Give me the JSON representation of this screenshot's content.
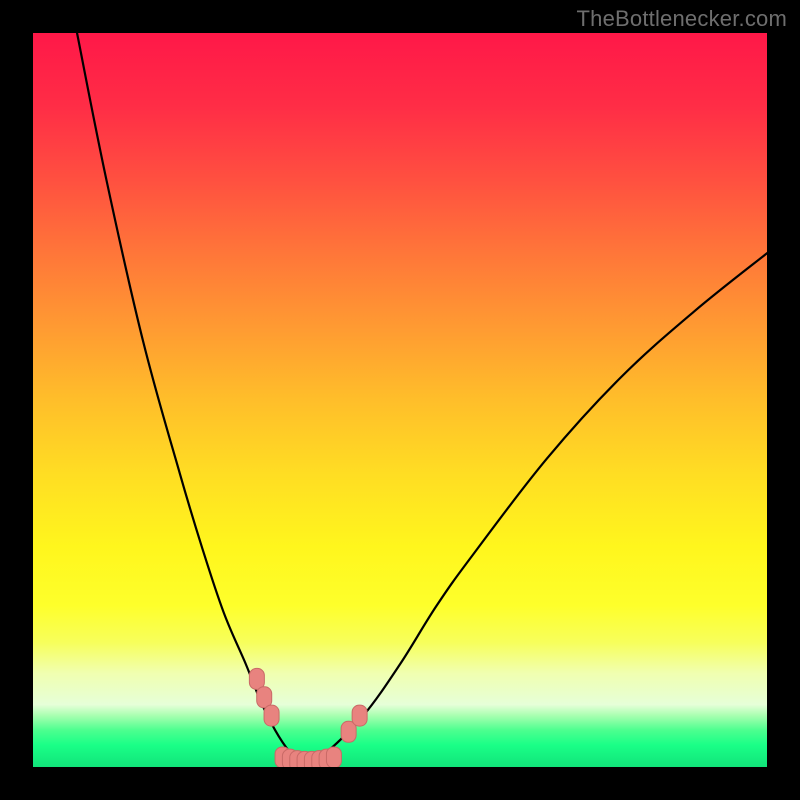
{
  "watermark_text": "TheBottlenecker.com",
  "colors": {
    "gradient_stops": [
      {
        "offset": 0.0,
        "hex": "#ff1848"
      },
      {
        "offset": 0.1,
        "hex": "#ff2d46"
      },
      {
        "offset": 0.2,
        "hex": "#ff5040"
      },
      {
        "offset": 0.3,
        "hex": "#ff7639"
      },
      {
        "offset": 0.4,
        "hex": "#ff9a32"
      },
      {
        "offset": 0.5,
        "hex": "#ffbe2a"
      },
      {
        "offset": 0.6,
        "hex": "#ffdd23"
      },
      {
        "offset": 0.7,
        "hex": "#fff61d"
      },
      {
        "offset": 0.78,
        "hex": "#feff2b"
      },
      {
        "offset": 0.83,
        "hex": "#f7ff5b"
      },
      {
        "offset": 0.872,
        "hex": "#f0ffb0"
      },
      {
        "offset": 0.915,
        "hex": "#e6ffd8"
      },
      {
        "offset": 0.93,
        "hex": "#a8ffb0"
      },
      {
        "offset": 0.95,
        "hex": "#4cff8f"
      },
      {
        "offset": 0.97,
        "hex": "#1aff87"
      },
      {
        "offset": 1.0,
        "hex": "#11e47a"
      }
    ],
    "curve_stroke": "#000000",
    "marker_fill": "#e8837f",
    "marker_stroke": "#c96a67",
    "frame_bg": "#000000"
  },
  "chart_data": {
    "type": "line",
    "title": "",
    "xlabel": "",
    "ylabel": "",
    "xlim": [
      0,
      100
    ],
    "ylim": [
      0,
      100
    ],
    "notes": "Y-axis is inverted visually (0 at bottom, 100 at top). Values are estimated percentage heights of the curve above the plot baseline. Two curve branches form a V shape meeting near x≈37 at the baseline.",
    "series": [
      {
        "name": "left-branch",
        "x": [
          6,
          10,
          15,
          20,
          23,
          26,
          29,
          31,
          33,
          35,
          37
        ],
        "y": [
          100,
          80,
          58,
          40,
          30,
          21,
          14,
          9,
          5,
          2,
          0
        ]
      },
      {
        "name": "right-branch",
        "x": [
          37,
          40,
          45,
          50,
          55,
          60,
          70,
          80,
          90,
          100
        ],
        "y": [
          0,
          2,
          7,
          14,
          22,
          29,
          42,
          53,
          62,
          70
        ]
      }
    ],
    "markers": {
      "name": "highlighted-points",
      "comment": "Salmon rounded markers near the valley; y values are percentage heights.",
      "points": [
        {
          "x": 30.5,
          "y": 12.0
        },
        {
          "x": 31.5,
          "y": 9.5
        },
        {
          "x": 32.5,
          "y": 7.0
        },
        {
          "x": 34.0,
          "y": 1.3
        },
        {
          "x": 35.0,
          "y": 1.0
        },
        {
          "x": 36.0,
          "y": 0.8
        },
        {
          "x": 37.0,
          "y": 0.7
        },
        {
          "x": 38.0,
          "y": 0.7
        },
        {
          "x": 39.0,
          "y": 0.8
        },
        {
          "x": 40.0,
          "y": 1.0
        },
        {
          "x": 41.0,
          "y": 1.3
        },
        {
          "x": 43.0,
          "y": 4.8
        },
        {
          "x": 44.5,
          "y": 7.0
        }
      ]
    }
  }
}
